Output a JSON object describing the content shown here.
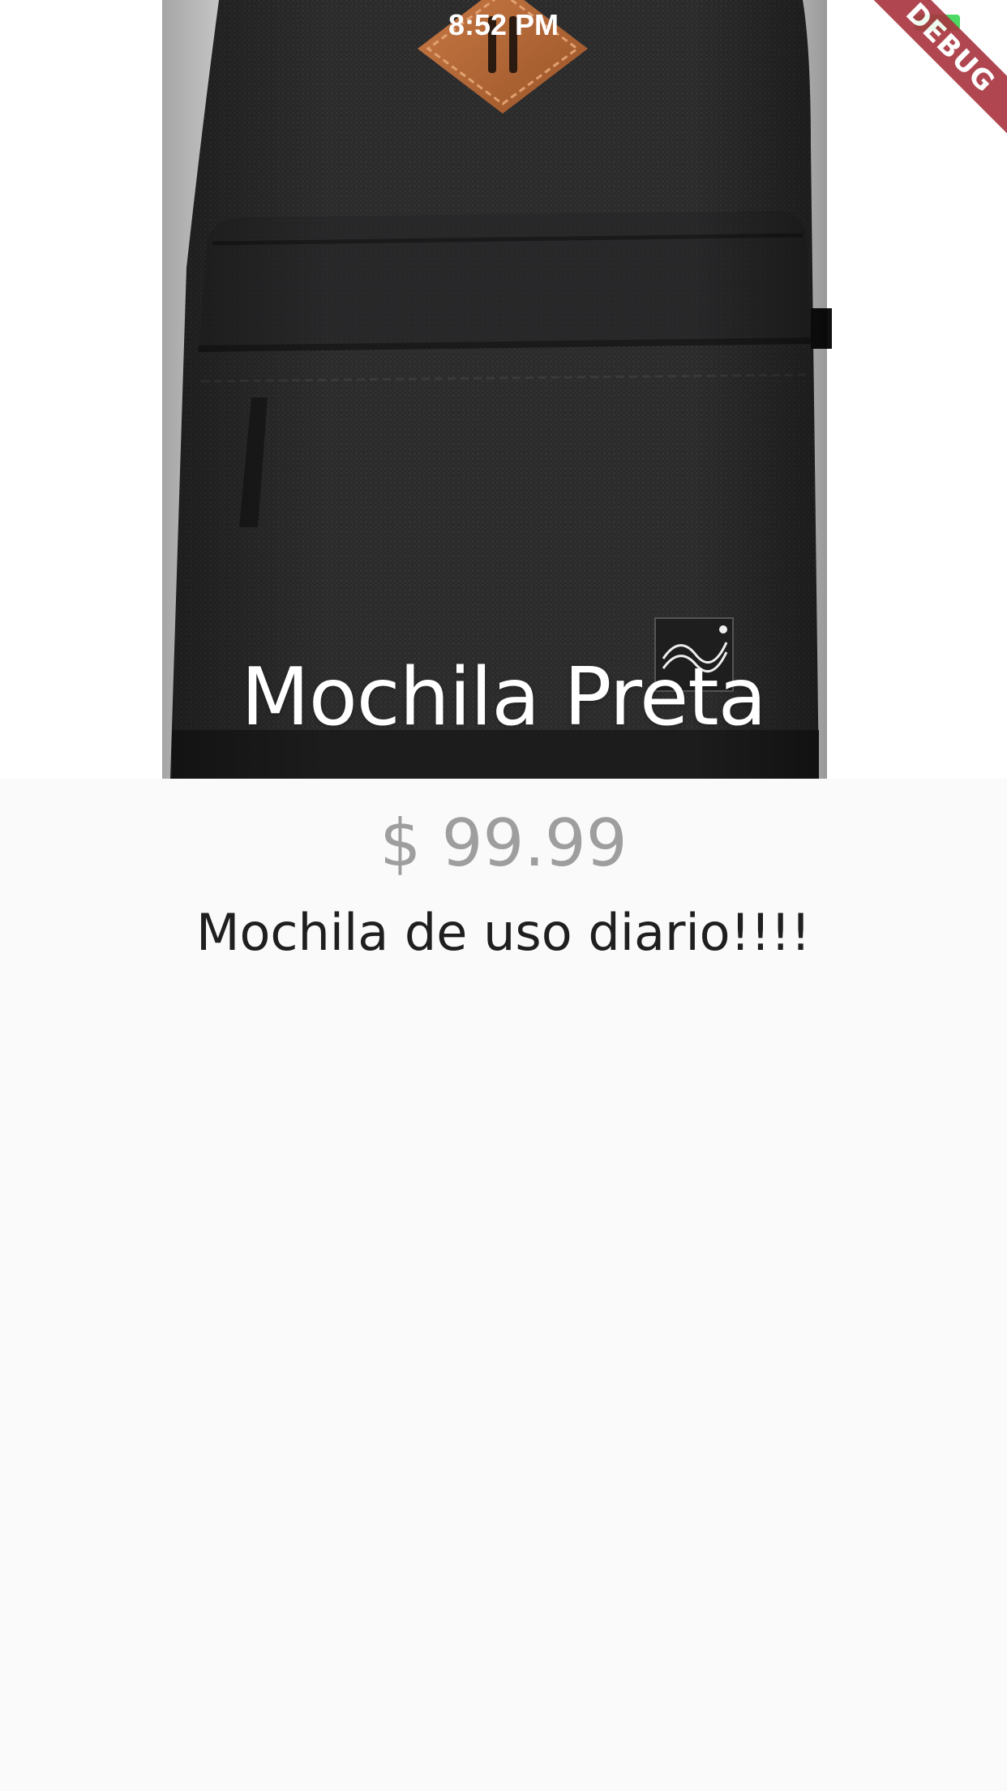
{
  "status_bar": {
    "time": "8:52 PM",
    "battery_color": "#4cd964"
  },
  "debug_banner": {
    "label": "DEBUG",
    "color": "#a8323e"
  },
  "product": {
    "title": "Mochila Preta",
    "price": "$ 99.99",
    "description": "Mochila de uso diario!!!!",
    "image_name": "black-backpack-photo"
  },
  "colors": {
    "background": "#fafafa",
    "price_text": "#9e9e9e",
    "description_text": "#1f1f1f",
    "title_text": "#ffffff"
  }
}
